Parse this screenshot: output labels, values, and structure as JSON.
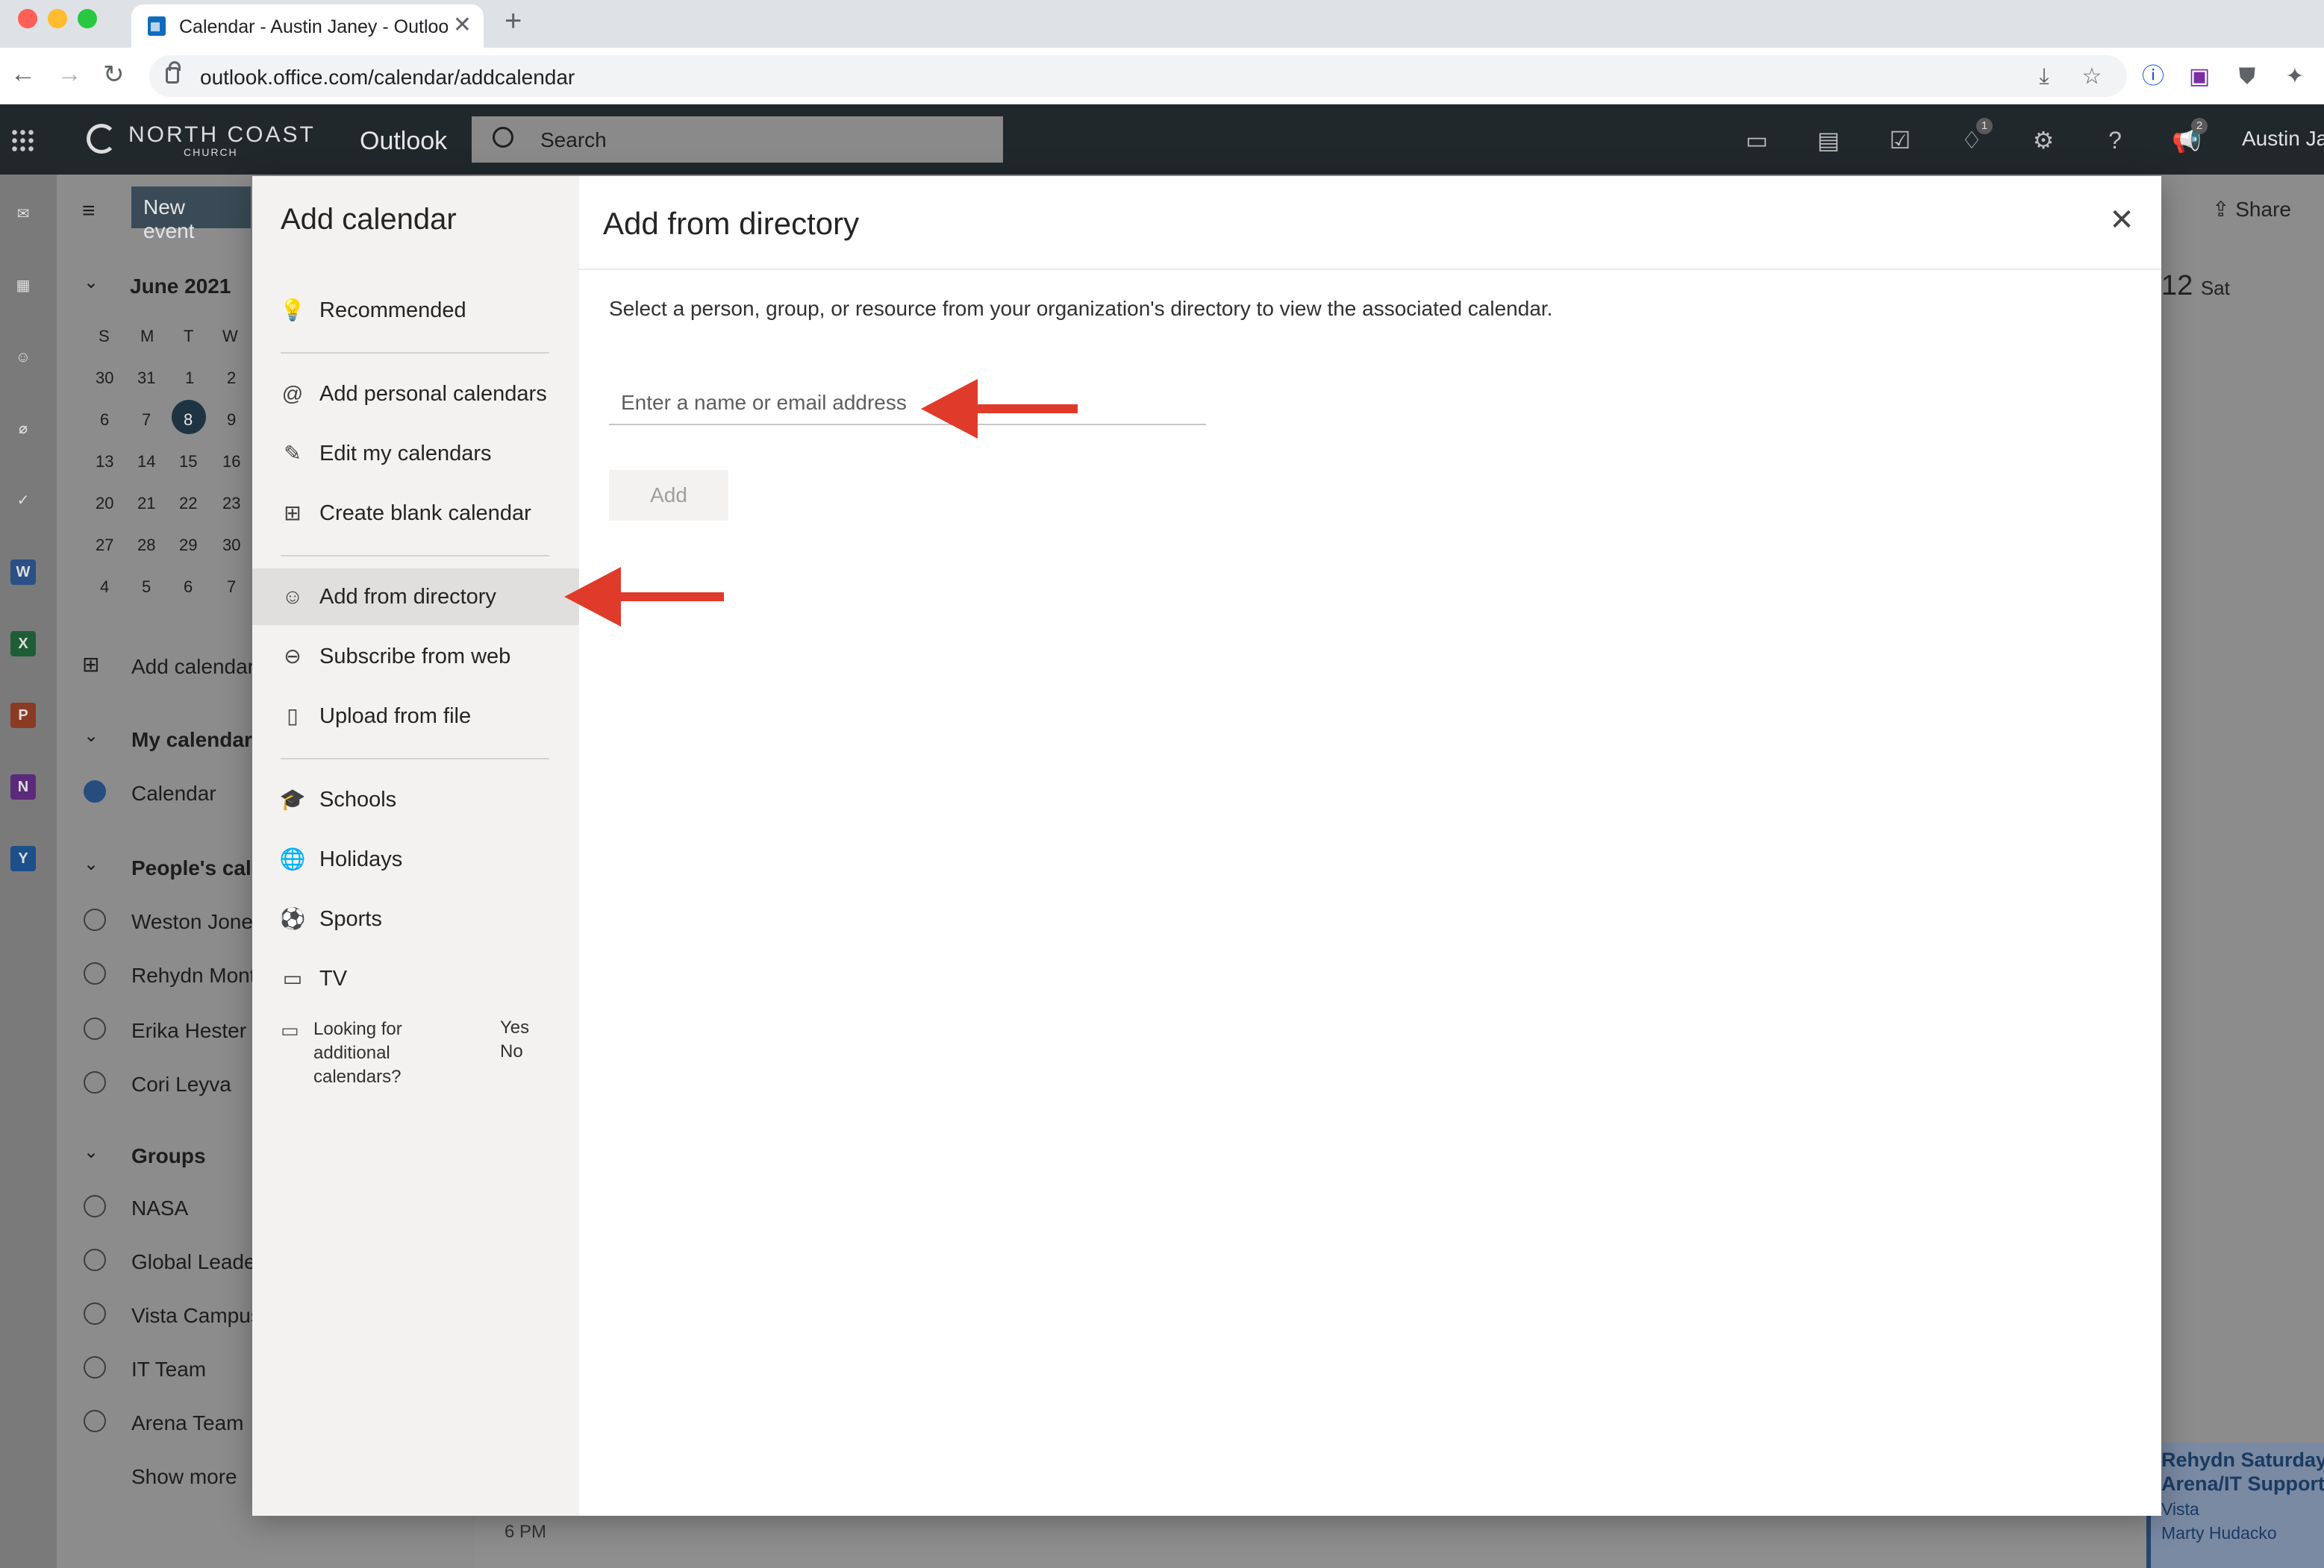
{
  "browser": {
    "tab_title": "Calendar - Austin Janey - Outlook",
    "url": "outlook.office.com/calendar/addcalendar"
  },
  "header": {
    "brand_main": "NORTH COAST",
    "brand_sub": "CHURCH",
    "app_name": "Outlook",
    "search_placeholder": "Search",
    "notification_badge": "1",
    "megaphone_badge": "2",
    "user_name": "Austin Janey"
  },
  "background": {
    "new_event_label": "New event",
    "month_label": "June 2021",
    "weekday_headers": [
      "S",
      "M",
      "T",
      "W"
    ],
    "mini_calendar_rows": [
      [
        "30",
        "31",
        "1",
        "2"
      ],
      [
        "6",
        "7",
        "8",
        "9"
      ],
      [
        "13",
        "14",
        "15",
        "16"
      ],
      [
        "20",
        "21",
        "22",
        "23"
      ],
      [
        "27",
        "28",
        "29",
        "30"
      ],
      [
        "4",
        "5",
        "6",
        "7"
      ]
    ],
    "add_calendar_label": "Add calendar",
    "my_calendars_label": "My calendars",
    "calendar_label": "Calendar",
    "peoples_calendars_label": "People's calendars",
    "people": [
      "Weston Jones",
      "Rehydn Montes",
      "Erika Hester",
      "Cori Leyva"
    ],
    "groups_label": "Groups",
    "groups": [
      "NASA",
      "Global Leaders",
      "Vista Campus",
      "IT Team",
      "Arena Team"
    ],
    "show_more_label": "Show more",
    "share_label": "Share",
    "day_header": "12",
    "day_name": "Sat",
    "time_label": "6 PM",
    "event": {
      "title1": "Rehydn Saturday",
      "title2": "Arena/IT Support",
      "location": "Vista",
      "organizer": "Marty Hudacko"
    }
  },
  "modal": {
    "title": "Add calendar",
    "nav": [
      {
        "label": "Recommended",
        "icon": "lightbulb-icon",
        "glyph": "💡"
      },
      {
        "label": "Add personal calendars",
        "icon": "at-icon",
        "glyph": "@"
      },
      {
        "label": "Edit my calendars",
        "icon": "edit-calendar-icon",
        "glyph": "✎"
      },
      {
        "label": "Create blank calendar",
        "icon": "calendar-add-icon",
        "glyph": "⊞"
      },
      {
        "label": "Add from directory",
        "icon": "people-icon",
        "glyph": "☺"
      },
      {
        "label": "Subscribe from web",
        "icon": "link-icon",
        "glyph": "⊖"
      },
      {
        "label": "Upload from file",
        "icon": "document-upload-icon",
        "glyph": "▯"
      },
      {
        "label": "Schools",
        "icon": "graduation-cap-icon",
        "glyph": "🎓"
      },
      {
        "label": "Holidays",
        "icon": "globe-icon",
        "glyph": "🌐"
      },
      {
        "label": "Sports",
        "icon": "ball-icon",
        "glyph": "⚽"
      },
      {
        "label": "TV",
        "icon": "tv-icon",
        "glyph": "▭"
      }
    ],
    "feedback_question": "Looking for additional calendars?",
    "feedback_yes": "Yes",
    "feedback_no": "No",
    "pane_title": "Add from directory",
    "description": "Select a person, group, or resource from your organization's directory to view the associated calendar.",
    "input_placeholder": "Enter a name or email address",
    "add_button": "Add"
  }
}
